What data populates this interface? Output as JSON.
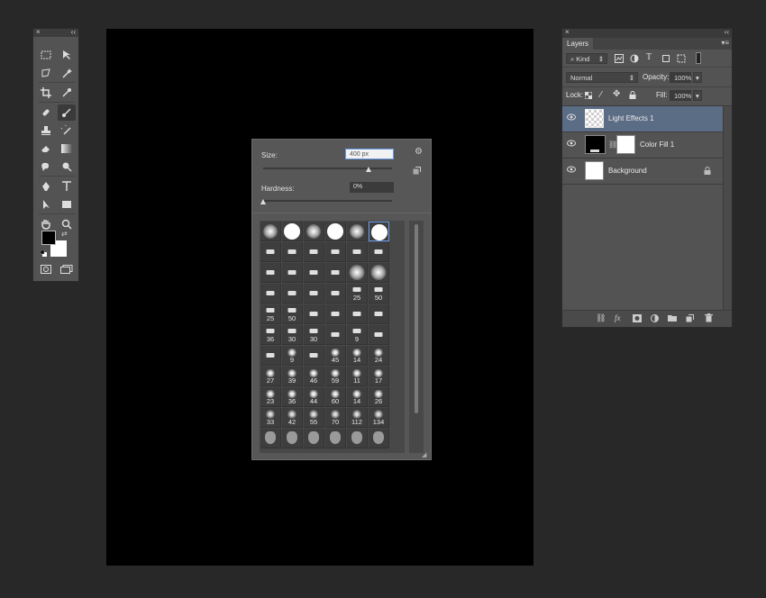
{
  "toolbox": {
    "close_glyph": "×",
    "collapse_glyph": "‹‹"
  },
  "brush_panel": {
    "size_label": "Size:",
    "size_value": "400 px",
    "hardness_label": "Hardness:",
    "hardness_value": "0%",
    "size_slider_fraction": 0.82,
    "hardness_slider_fraction": 0.0,
    "rows": [
      [
        "",
        "",
        "",
        "",
        "",
        ""
      ],
      [
        "",
        "",
        "",
        "",
        "",
        ""
      ],
      [
        "",
        "",
        "",
        "",
        "",
        ""
      ],
      [
        "",
        "",
        "",
        "",
        "25",
        "50"
      ],
      [
        "25",
        "50",
        "",
        "",
        "",
        ""
      ],
      [
        "36",
        "30",
        "30",
        "",
        "9",
        ""
      ],
      [
        "",
        "9",
        "",
        "45",
        "14",
        "24"
      ],
      [
        "27",
        "39",
        "46",
        "59",
        "11",
        "17"
      ],
      [
        "23",
        "36",
        "44",
        "60",
        "14",
        "26"
      ],
      [
        "33",
        "42",
        "55",
        "70",
        "112",
        "134"
      ],
      [
        "",
        "",
        "",
        "",
        "",
        ""
      ]
    ]
  },
  "layers_panel": {
    "close_glyph": "×",
    "collapse_glyph": "‹‹",
    "tab_label": "Layers",
    "filter_label": "Kind",
    "blend_mode": "Normal",
    "opacity_label": "Opacity:",
    "opacity_value": "100%",
    "lock_label": "Lock:",
    "fill_label": "Fill:",
    "fill_value": "100%",
    "layers": [
      {
        "name": "Light Effects 1"
      },
      {
        "name": "Color Fill 1"
      },
      {
        "name": "Background"
      }
    ]
  },
  "colors": {
    "foreground": "#000000",
    "background": "#ffffff",
    "selected_layer": "#5b6c85",
    "focus_outline": "#6a9ce8"
  }
}
